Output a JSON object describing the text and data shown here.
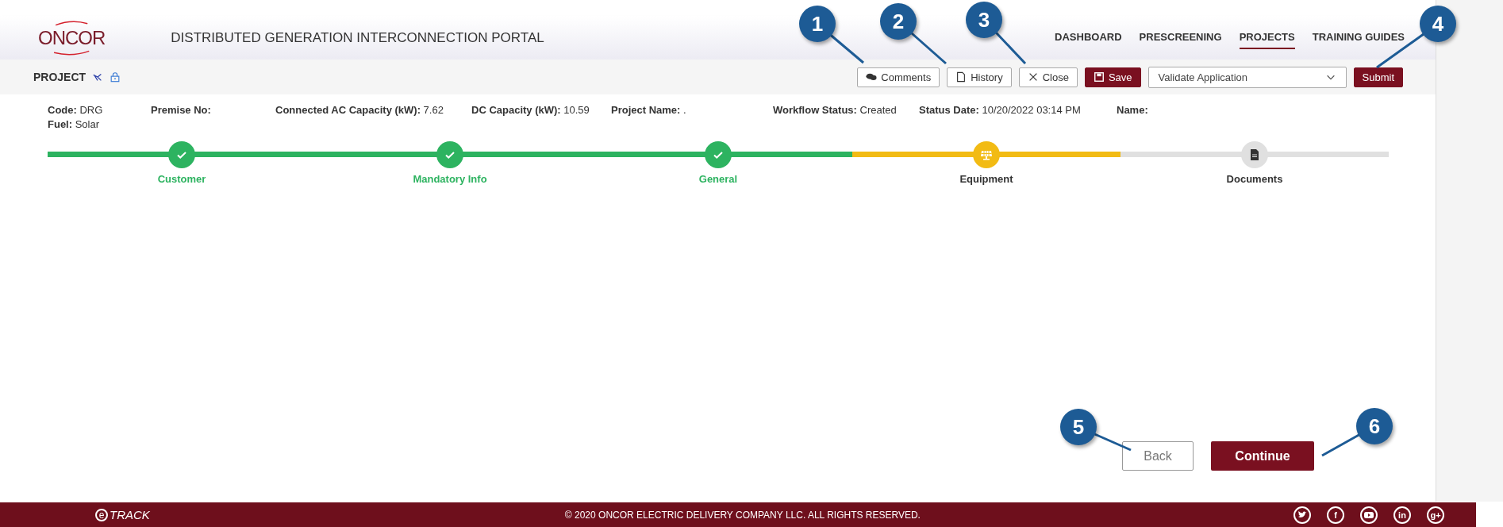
{
  "header": {
    "logo": "ONCOR",
    "title": "DISTRIBUTED GENERATION INTERCONNECTION PORTAL",
    "nav": [
      {
        "label": "DASHBOARD",
        "selected": false
      },
      {
        "label": "PRESCREENING",
        "selected": false
      },
      {
        "label": "PROJECTS",
        "selected": true
      },
      {
        "label": "TRAINING GUIDES",
        "selected": false
      }
    ]
  },
  "toolbar": {
    "title": "PROJECT",
    "buttons": [
      {
        "label": "Comments",
        "kind": "comments"
      },
      {
        "label": "History",
        "kind": "history"
      },
      {
        "label": "Close",
        "kind": "close"
      },
      {
        "label": "Save",
        "kind": "save"
      }
    ],
    "action_select": {
      "value": "Validate Application"
    },
    "submit": "Submit"
  },
  "project_info": [
    [
      {
        "label": "Code:",
        "value": "DRG"
      },
      {
        "label": "Fuel:",
        "value": "Solar"
      }
    ],
    [
      {
        "label": "Premise No:"
      }
    ],
    [
      {
        "label": "Connected AC Capacity (kW):",
        "value": "7.62"
      }
    ],
    [
      {
        "label": "DC Capacity (kW):",
        "value": "10.59"
      }
    ],
    [
      {
        "label": "Project Name:",
        "value": "."
      }
    ],
    [
      {
        "label": "Workflow Status:",
        "value": "Created"
      }
    ],
    [
      {
        "label": "Status Date:",
        "value": "10/20/2022 03:14 PM"
      }
    ],
    [
      {
        "label": "Name:"
      }
    ]
  ],
  "steps": [
    {
      "label": "Customer",
      "completed": true,
      "current": false,
      "kind": "check"
    },
    {
      "label": "Mandatory Info",
      "completed": true,
      "current": false,
      "kind": "check"
    },
    {
      "label": "General",
      "completed": true,
      "current": false,
      "kind": "check"
    },
    {
      "label": "Equipment",
      "completed": false,
      "current": true,
      "kind": "solar"
    },
    {
      "label": "Documents",
      "completed": false,
      "current": false,
      "kind": "document"
    }
  ],
  "actions": {
    "back": "Back",
    "continue": "Continue"
  },
  "footer": {
    "logo_mark": "e",
    "logo_text": "TRACK",
    "copyright": "© 2020 ONCOR ELECTRIC DELIVERY COMPANY LLC. ALL RIGHTS RESERVED.",
    "social": [
      {
        "kind": "bird"
      },
      {
        "kind": "text",
        "label": "f"
      },
      {
        "kind": "play"
      },
      {
        "kind": "text",
        "label": "in"
      },
      {
        "kind": "text",
        "label": "g+"
      }
    ]
  },
  "callouts": [
    {
      "number": "1"
    },
    {
      "number": "2"
    },
    {
      "number": "3"
    },
    {
      "number": "4"
    },
    {
      "number": "5"
    },
    {
      "number": "6"
    }
  ]
}
